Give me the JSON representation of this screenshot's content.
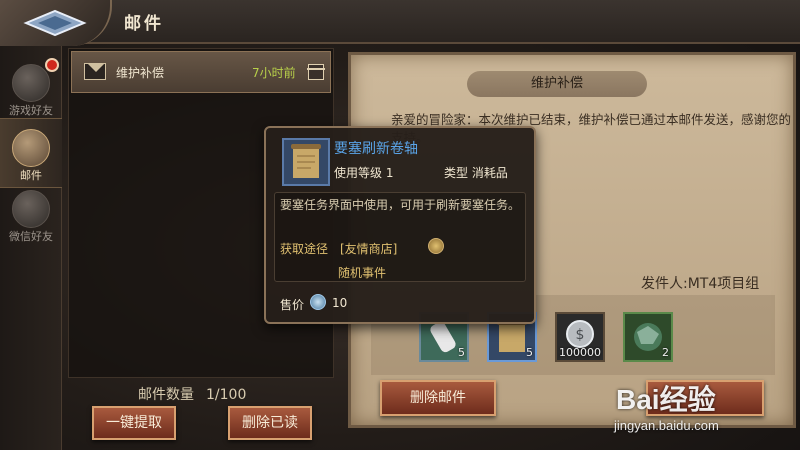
{
  "header": {
    "title": "邮件"
  },
  "sidebar": {
    "items": [
      {
        "label": "游戏好友",
        "icon": "friends-icon",
        "badge": true
      },
      {
        "label": "邮件",
        "icon": "mail-icon",
        "active": true
      },
      {
        "label": "微信好友",
        "icon": "handshake-icon"
      }
    ]
  },
  "mail_list": {
    "items": [
      {
        "title": "维护补偿",
        "time": "7小时前",
        "icon": "envelope-icon",
        "attachment_icon": "gift-icon"
      }
    ],
    "count_label": "邮件数量",
    "count_value": "1/100",
    "claim_all_label": "一键提取",
    "delete_read_label": "删除已读"
  },
  "detail": {
    "title": "维护补偿",
    "body": "亲爱的冒险家：本次维护已结束，维护补偿已通过本邮件发送，感谢您的支持。",
    "sender": "发件人:MT4项目组",
    "attachments": [
      {
        "icon": "bottle-icon",
        "qty": "5"
      },
      {
        "icon": "scroll-icon",
        "qty": "5"
      },
      {
        "icon": "coin-icon",
        "qty": "100000"
      },
      {
        "icon": "beast-icon",
        "qty": "2"
      }
    ],
    "delete_label": "删除邮件"
  },
  "tooltip": {
    "name": "要塞刷新卷轴",
    "level": "使用等级 1",
    "type": "类型  消耗品",
    "desc": "要塞任务界面中使用，可用于刷新要塞任务。",
    "source_label": "获取途径",
    "source_value": "[友情商店]",
    "source_value2": "随机事件",
    "price_label": "售价",
    "price": "10"
  },
  "watermark": {
    "logo": "Bai经验",
    "url": "jingyan.baidu.com"
  },
  "colors": {
    "accent": "#a85a3e",
    "time_green": "#b8d04a",
    "item_name_blue": "#5aa4e8"
  }
}
